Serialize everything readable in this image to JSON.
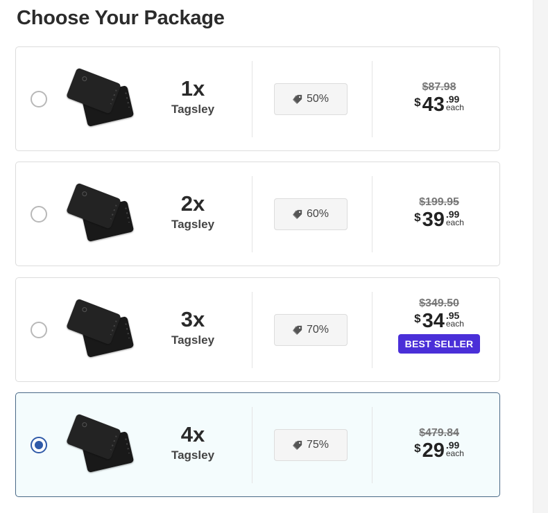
{
  "heading": "Choose Your Package",
  "packages": [
    {
      "quantity": "1x",
      "product": "Tagsley",
      "discount": "50%",
      "old_price": "$87.98",
      "currency": "$",
      "price_whole": "43",
      "price_cents": ".99",
      "unit": "each",
      "badge": "",
      "selected": false
    },
    {
      "quantity": "2x",
      "product": "Tagsley",
      "discount": "60%",
      "old_price": "$199.95",
      "currency": "$",
      "price_whole": "39",
      "price_cents": ".99",
      "unit": "each",
      "badge": "",
      "selected": false
    },
    {
      "quantity": "3x",
      "product": "Tagsley",
      "discount": "70%",
      "old_price": "$349.50",
      "currency": "$",
      "price_whole": "34",
      "price_cents": ".95",
      "unit": "each",
      "badge": "BEST SELLER",
      "selected": false
    },
    {
      "quantity": "4x",
      "product": "Tagsley",
      "discount": "75%",
      "old_price": "$479.84",
      "currency": "$",
      "price_whole": "29",
      "price_cents": ".99",
      "unit": "each",
      "badge": "",
      "selected": true
    }
  ],
  "icons": {
    "radio": "radio-button-icon",
    "discount": "tag-icon",
    "product": "card-icon"
  },
  "colors": {
    "selected_border": "#486886",
    "selected_background": "#f4fcfd",
    "radio_selected": "#2f5aa8",
    "badge_background": "#4a2fd8"
  }
}
